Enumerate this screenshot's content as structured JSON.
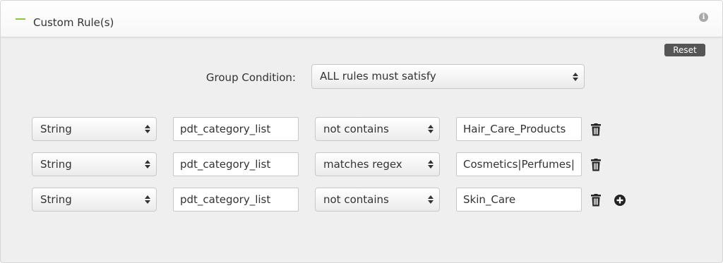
{
  "header": {
    "title": "Custom Rule(s)",
    "icons": {
      "collapse": "collapse-dash-icon",
      "info": "info-icon"
    }
  },
  "toolbar": {
    "reset_label": "Reset"
  },
  "group": {
    "label": "Group Condition:",
    "selected": "ALL rules must satisfy"
  },
  "rules": [
    {
      "type": "String",
      "field": "pdt_category_list",
      "operator": "not contains",
      "value": "Hair_Care_Products"
    },
    {
      "type": "String",
      "field": "pdt_category_list",
      "operator": "matches regex",
      "value": "Cosmetics|Perfumes|"
    },
    {
      "type": "String",
      "field": "pdt_category_list",
      "operator": "not contains",
      "value": "Skin_Care"
    }
  ],
  "colors": {
    "accent": "#8cc63f",
    "reset_bg": "#555555",
    "panel_bg": "#efefef"
  },
  "icons": {
    "delete": "trash-icon",
    "add": "plus-circle-icon"
  }
}
